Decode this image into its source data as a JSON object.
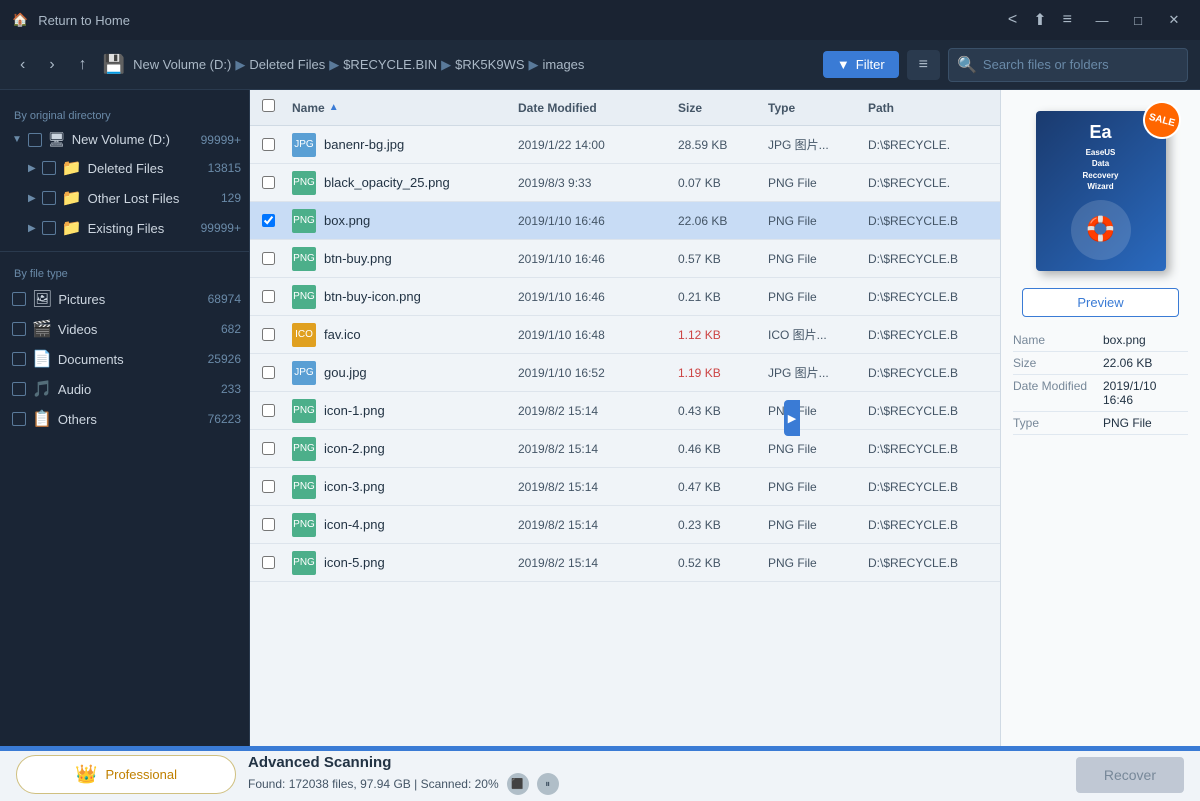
{
  "titleBar": {
    "title": "Return to Home",
    "icons": {
      "share": "<",
      "upload": "⬆",
      "menu": "≡",
      "minimize": "—",
      "maximize": "□",
      "close": "✕"
    }
  },
  "toolbar": {
    "backLabel": "‹",
    "forwardLabel": "›",
    "upLabel": "↑",
    "filterLabel": "Filter",
    "menuLabel": "≡",
    "searchPlaceholder": "Search files or folders",
    "breadcrumb": [
      "New Volume (D:)",
      "Deleted Files",
      "$RECYCLE.BIN",
      "$RK5K9WS",
      "images"
    ]
  },
  "sidebar": {
    "sectionOriginal": "By original directory",
    "sectionFileType": "By file type",
    "treeItems": [
      {
        "label": "New Volume (D:)",
        "count": "99999+",
        "indent": 0,
        "expanded": true
      },
      {
        "label": "Deleted Files",
        "count": "13815",
        "indent": 1,
        "expanded": false
      },
      {
        "label": "Other Lost Files",
        "count": "129",
        "indent": 1,
        "expanded": false
      },
      {
        "label": "Existing Files",
        "count": "99999+",
        "indent": 1,
        "expanded": false
      }
    ],
    "fileTypes": [
      {
        "label": "Pictures",
        "count": "68974"
      },
      {
        "label": "Videos",
        "count": "682"
      },
      {
        "label": "Documents",
        "count": "25926"
      },
      {
        "label": "Audio",
        "count": "233"
      },
      {
        "label": "Others",
        "count": "76223"
      }
    ]
  },
  "fileList": {
    "columns": [
      "Name",
      "Date Modified",
      "Size",
      "Type",
      "Path"
    ],
    "files": [
      {
        "name": "banenr-bg.jpg",
        "date": "2019/1/22 14:00",
        "size": "28.59 KB",
        "type": "JPG 图片...",
        "path": "D:\\$RECYCLE.",
        "ext": "jpg",
        "selected": false
      },
      {
        "name": "black_opacity_25.png",
        "date": "2019/8/3 9:33",
        "size": "0.07 KB",
        "type": "PNG File",
        "path": "D:\\$RECYCLE.",
        "ext": "png",
        "selected": false
      },
      {
        "name": "box.png",
        "date": "2019/1/10 16:46",
        "size": "22.06 KB",
        "type": "PNG File",
        "path": "D:\\$RECYCLE.B",
        "ext": "png",
        "selected": true
      },
      {
        "name": "btn-buy.png",
        "date": "2019/1/10 16:46",
        "size": "0.57 KB",
        "type": "PNG File",
        "path": "D:\\$RECYCLE.B",
        "ext": "png",
        "selected": false
      },
      {
        "name": "btn-buy-icon.png",
        "date": "2019/1/10 16:46",
        "size": "0.21 KB",
        "type": "PNG File",
        "path": "D:\\$RECYCLE.B",
        "ext": "png",
        "selected": false
      },
      {
        "name": "fav.ico",
        "date": "2019/1/10 16:48",
        "size": "1.12 KB",
        "type": "ICO 图片...",
        "path": "D:\\$RECYCLE.B",
        "ext": "ico",
        "selected": false,
        "redSize": true
      },
      {
        "name": "gou.jpg",
        "date": "2019/1/10 16:52",
        "size": "1.19 KB",
        "type": "JPG 图片...",
        "path": "D:\\$RECYCLE.B",
        "ext": "jpg",
        "selected": false,
        "redSize": true
      },
      {
        "name": "icon-1.png",
        "date": "2019/8/2 15:14",
        "size": "0.43 KB",
        "type": "PNG File",
        "path": "D:\\$RECYCLE.B",
        "ext": "png",
        "selected": false
      },
      {
        "name": "icon-2.png",
        "date": "2019/8/2 15:14",
        "size": "0.46 KB",
        "type": "PNG File",
        "path": "D:\\$RECYCLE.B",
        "ext": "png",
        "selected": false
      },
      {
        "name": "icon-3.png",
        "date": "2019/8/2 15:14",
        "size": "0.47 KB",
        "type": "PNG File",
        "path": "D:\\$RECYCLE.B",
        "ext": "png",
        "selected": false
      },
      {
        "name": "icon-4.png",
        "date": "2019/8/2 15:14",
        "size": "0.23 KB",
        "type": "PNG File",
        "path": "D:\\$RECYCLE.B",
        "ext": "png",
        "selected": false
      },
      {
        "name": "icon-5.png",
        "date": "2019/8/2 15:14",
        "size": "0.52 KB",
        "type": "PNG File",
        "path": "D:\\$RECYCLE.B",
        "ext": "png",
        "selected": false
      }
    ]
  },
  "rightPanel": {
    "previewLabel": "Preview",
    "productTitle": "EaseUS\nData Recovery\nWizard",
    "saleLabel": "SALE",
    "fileInfo": {
      "name": "box.png",
      "size": "22.06 KB",
      "dateModified": "2019/1/10 16:46",
      "type": "PNG File"
    },
    "labels": {
      "name": "Name",
      "size": "Size",
      "dateModified": "Date Modified",
      "type": "Type"
    }
  },
  "bottomBar": {
    "proLabel": "Professional",
    "scanTitle": "Advanced Scanning",
    "scanStats": "Found: 172038 files, 97.94 GB | Scanned: 20%",
    "recoverLabel": "Recover"
  }
}
